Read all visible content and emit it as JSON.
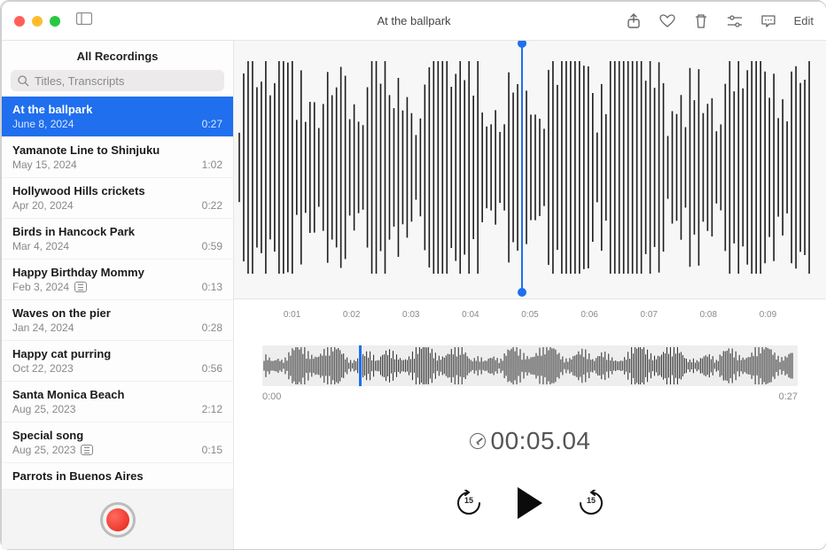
{
  "window": {
    "title": "At the ballpark",
    "edit_label": "Edit"
  },
  "sidebar": {
    "header": "All Recordings",
    "search_placeholder": "Titles, Transcripts",
    "recordings": [
      {
        "title": "At the ballpark",
        "date": "June 8, 2024",
        "duration": "0:27",
        "selected": true,
        "transcript": false
      },
      {
        "title": "Yamanote Line to Shinjuku",
        "date": "May 15, 2024",
        "duration": "1:02",
        "selected": false,
        "transcript": false
      },
      {
        "title": "Hollywood Hills crickets",
        "date": "Apr 20, 2024",
        "duration": "0:22",
        "selected": false,
        "transcript": false
      },
      {
        "title": "Birds in Hancock Park",
        "date": "Mar 4, 2024",
        "duration": "0:59",
        "selected": false,
        "transcript": false
      },
      {
        "title": "Happy Birthday Mommy",
        "date": "Feb 3, 2024",
        "duration": "0:13",
        "selected": false,
        "transcript": true
      },
      {
        "title": "Waves on the pier",
        "date": "Jan 24, 2024",
        "duration": "0:28",
        "selected": false,
        "transcript": false
      },
      {
        "title": "Happy cat purring",
        "date": "Oct 22, 2023",
        "duration": "0:56",
        "selected": false,
        "transcript": false
      },
      {
        "title": "Santa Monica Beach",
        "date": "Aug 25, 2023",
        "duration": "2:12",
        "selected": false,
        "transcript": false
      },
      {
        "title": "Special song",
        "date": "Aug 25, 2023",
        "duration": "0:15",
        "selected": false,
        "transcript": true
      },
      {
        "title": "Parrots in Buenos Aires",
        "date": "",
        "duration": "",
        "selected": false,
        "transcript": false
      }
    ]
  },
  "detail": {
    "timeline_ticks": [
      "0:01",
      "0:02",
      "0:03",
      "0:04",
      "0:05",
      "0:06",
      "0:07",
      "0:08",
      "0:09"
    ],
    "overview": {
      "start": "0:00",
      "end": "0:27",
      "playhead_pct": 18
    },
    "main_playhead_pct": 48.5,
    "current_time": "00:05.04",
    "skip_seconds": "15"
  }
}
